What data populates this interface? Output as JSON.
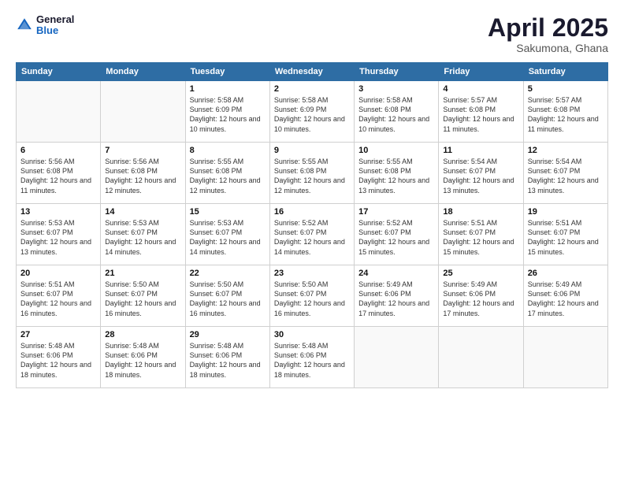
{
  "header": {
    "logo_general": "General",
    "logo_blue": "Blue",
    "title": "April 2025",
    "location": "Sakumona, Ghana"
  },
  "weekdays": [
    "Sunday",
    "Monday",
    "Tuesday",
    "Wednesday",
    "Thursday",
    "Friday",
    "Saturday"
  ],
  "weeks": [
    [
      {
        "day": "",
        "info": ""
      },
      {
        "day": "",
        "info": ""
      },
      {
        "day": "1",
        "info": "Sunrise: 5:58 AM\nSunset: 6:09 PM\nDaylight: 12 hours and 10 minutes."
      },
      {
        "day": "2",
        "info": "Sunrise: 5:58 AM\nSunset: 6:09 PM\nDaylight: 12 hours and 10 minutes."
      },
      {
        "day": "3",
        "info": "Sunrise: 5:58 AM\nSunset: 6:08 PM\nDaylight: 12 hours and 10 minutes."
      },
      {
        "day": "4",
        "info": "Sunrise: 5:57 AM\nSunset: 6:08 PM\nDaylight: 12 hours and 11 minutes."
      },
      {
        "day": "5",
        "info": "Sunrise: 5:57 AM\nSunset: 6:08 PM\nDaylight: 12 hours and 11 minutes."
      }
    ],
    [
      {
        "day": "6",
        "info": "Sunrise: 5:56 AM\nSunset: 6:08 PM\nDaylight: 12 hours and 11 minutes."
      },
      {
        "day": "7",
        "info": "Sunrise: 5:56 AM\nSunset: 6:08 PM\nDaylight: 12 hours and 12 minutes."
      },
      {
        "day": "8",
        "info": "Sunrise: 5:55 AM\nSunset: 6:08 PM\nDaylight: 12 hours and 12 minutes."
      },
      {
        "day": "9",
        "info": "Sunrise: 5:55 AM\nSunset: 6:08 PM\nDaylight: 12 hours and 12 minutes."
      },
      {
        "day": "10",
        "info": "Sunrise: 5:55 AM\nSunset: 6:08 PM\nDaylight: 12 hours and 13 minutes."
      },
      {
        "day": "11",
        "info": "Sunrise: 5:54 AM\nSunset: 6:07 PM\nDaylight: 12 hours and 13 minutes."
      },
      {
        "day": "12",
        "info": "Sunrise: 5:54 AM\nSunset: 6:07 PM\nDaylight: 12 hours and 13 minutes."
      }
    ],
    [
      {
        "day": "13",
        "info": "Sunrise: 5:53 AM\nSunset: 6:07 PM\nDaylight: 12 hours and 13 minutes."
      },
      {
        "day": "14",
        "info": "Sunrise: 5:53 AM\nSunset: 6:07 PM\nDaylight: 12 hours and 14 minutes."
      },
      {
        "day": "15",
        "info": "Sunrise: 5:53 AM\nSunset: 6:07 PM\nDaylight: 12 hours and 14 minutes."
      },
      {
        "day": "16",
        "info": "Sunrise: 5:52 AM\nSunset: 6:07 PM\nDaylight: 12 hours and 14 minutes."
      },
      {
        "day": "17",
        "info": "Sunrise: 5:52 AM\nSunset: 6:07 PM\nDaylight: 12 hours and 15 minutes."
      },
      {
        "day": "18",
        "info": "Sunrise: 5:51 AM\nSunset: 6:07 PM\nDaylight: 12 hours and 15 minutes."
      },
      {
        "day": "19",
        "info": "Sunrise: 5:51 AM\nSunset: 6:07 PM\nDaylight: 12 hours and 15 minutes."
      }
    ],
    [
      {
        "day": "20",
        "info": "Sunrise: 5:51 AM\nSunset: 6:07 PM\nDaylight: 12 hours and 16 minutes."
      },
      {
        "day": "21",
        "info": "Sunrise: 5:50 AM\nSunset: 6:07 PM\nDaylight: 12 hours and 16 minutes."
      },
      {
        "day": "22",
        "info": "Sunrise: 5:50 AM\nSunset: 6:07 PM\nDaylight: 12 hours and 16 minutes."
      },
      {
        "day": "23",
        "info": "Sunrise: 5:50 AM\nSunset: 6:07 PM\nDaylight: 12 hours and 16 minutes."
      },
      {
        "day": "24",
        "info": "Sunrise: 5:49 AM\nSunset: 6:06 PM\nDaylight: 12 hours and 17 minutes."
      },
      {
        "day": "25",
        "info": "Sunrise: 5:49 AM\nSunset: 6:06 PM\nDaylight: 12 hours and 17 minutes."
      },
      {
        "day": "26",
        "info": "Sunrise: 5:49 AM\nSunset: 6:06 PM\nDaylight: 12 hours and 17 minutes."
      }
    ],
    [
      {
        "day": "27",
        "info": "Sunrise: 5:48 AM\nSunset: 6:06 PM\nDaylight: 12 hours and 18 minutes."
      },
      {
        "day": "28",
        "info": "Sunrise: 5:48 AM\nSunset: 6:06 PM\nDaylight: 12 hours and 18 minutes."
      },
      {
        "day": "29",
        "info": "Sunrise: 5:48 AM\nSunset: 6:06 PM\nDaylight: 12 hours and 18 minutes."
      },
      {
        "day": "30",
        "info": "Sunrise: 5:48 AM\nSunset: 6:06 PM\nDaylight: 12 hours and 18 minutes."
      },
      {
        "day": "",
        "info": ""
      },
      {
        "day": "",
        "info": ""
      },
      {
        "day": "",
        "info": ""
      }
    ]
  ]
}
